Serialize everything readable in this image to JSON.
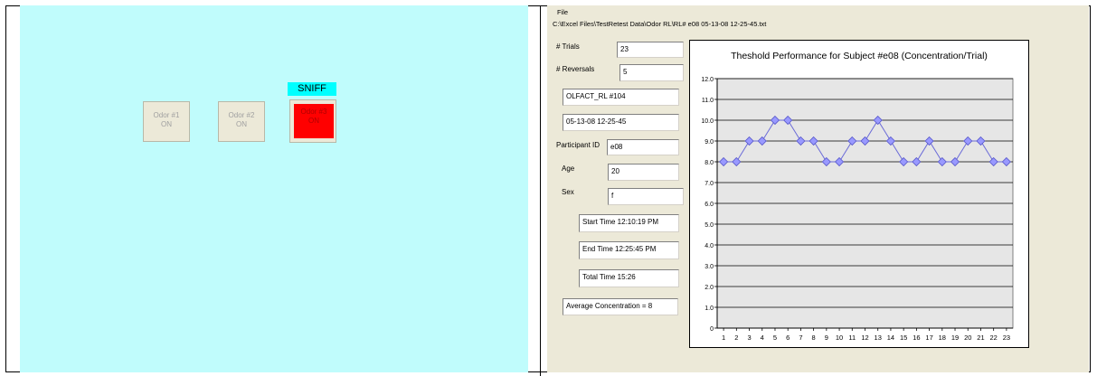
{
  "left": {
    "sniff_label": "SNIFF",
    "odor_buttons": [
      {
        "line1": "Odor #1",
        "line2": "ON"
      },
      {
        "line1": "Odor #2",
        "line2": "ON"
      },
      {
        "line1": "Odor #3",
        "line2": "ON"
      }
    ],
    "colors": {
      "background": "#c0fcfc",
      "sniff": "#00ffff",
      "active_odor": "#ff0000"
    }
  },
  "right": {
    "menu_file": "File",
    "file_path": "C:\\Excel Files\\TestRetest Data\\Odor RL\\RL# e08   05-13-08 12-25-45.txt",
    "trials_label": "# Trials",
    "trials_value": "23",
    "reversals_label": "# Reversals",
    "reversals_value": "5",
    "test_name": "OLFACT_RL #104",
    "datetime": "05-13-08 12-25-45",
    "participant_label": "Participant ID",
    "participant_value": "e08",
    "age_label": "Age",
    "age_value": "20",
    "sex_label": "Sex",
    "sex_value": "f",
    "start_time": "Start Time    12:10:19 PM",
    "end_time": "End Time     12:25:45 PM",
    "total_time": "Total Time  15:26",
    "average": "Average Concentration = 8"
  },
  "chart_data": {
    "type": "line",
    "title": "Theshold Performance for Subject #e08 (Concentration/Trial)",
    "xlabel": "",
    "ylabel": "",
    "categories": [
      "1",
      "2",
      "3",
      "4",
      "5",
      "6",
      "7",
      "8",
      "9",
      "10",
      "11",
      "12",
      "13",
      "14",
      "15",
      "16",
      "17",
      "18",
      "19",
      "20",
      "21",
      "22",
      "23"
    ],
    "values": [
      8,
      8,
      9,
      9,
      10,
      10,
      9,
      9,
      8,
      8,
      9,
      9,
      10,
      9,
      8,
      8,
      9,
      8,
      8,
      9,
      9,
      8,
      8
    ],
    "ylim": [
      0,
      12
    ],
    "yticks": [
      "0",
      "1.0",
      "2.0",
      "3.0",
      "4.0",
      "5.0",
      "6.0",
      "7.0",
      "8.0",
      "9.0",
      "10.0",
      "11.0",
      "12.0"
    ],
    "grid": true,
    "colors": {
      "line": "#6b6bd8",
      "marker": "#9999ff",
      "plot_bg": "#e6e6e6"
    }
  }
}
